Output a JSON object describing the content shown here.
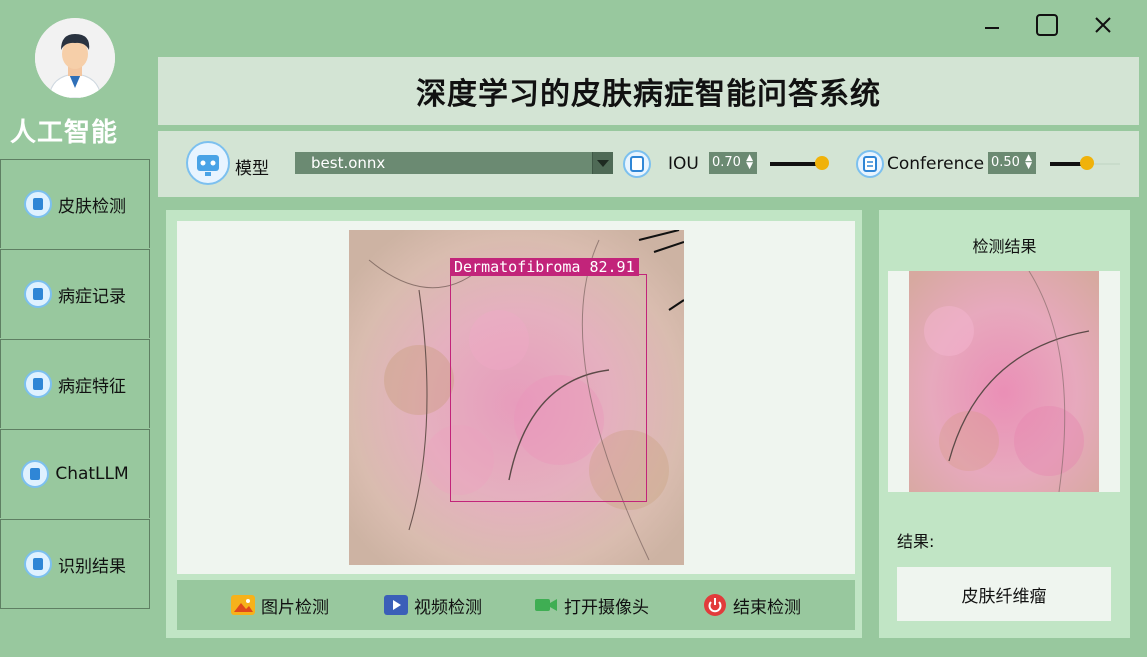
{
  "window": {
    "controls": [
      "minimize-icon",
      "maximize-icon",
      "close-icon"
    ]
  },
  "sidebar": {
    "brand": "人工智能",
    "items": [
      {
        "label": "皮肤检测",
        "icon": "skin-detect-icon"
      },
      {
        "label": "病症记录",
        "icon": "record-icon"
      },
      {
        "label": "病症特征",
        "icon": "feature-icon"
      },
      {
        "label": "ChatLLM",
        "icon": "chat-icon"
      },
      {
        "label": "识别结果",
        "icon": "folder-icon"
      }
    ]
  },
  "header": {
    "title": "深度学习的皮肤病症智能问答系统"
  },
  "toolbar": {
    "model_label": "模型",
    "model_value": "best.onnx",
    "iou_label": "IOU",
    "iou_value": "0.70",
    "iou_level": 0.7,
    "conf_label": "Conference",
    "conf_value": "0.50",
    "conf_level": 0.5
  },
  "detection": {
    "box_label": "Dermatofibroma 82.91",
    "box_color": "#c2247a"
  },
  "actions": [
    {
      "label": "图片检测",
      "icon": "image-icon"
    },
    {
      "label": "视频检测",
      "icon": "video-icon"
    },
    {
      "label": "打开摄像头",
      "icon": "camera-icon"
    },
    {
      "label": "结束检测",
      "icon": "power-icon"
    }
  ],
  "result": {
    "title": "检测结果",
    "label": "结果:",
    "value": "皮肤纤维瘤"
  },
  "colors": {
    "background": "#98c89e",
    "panel": "#c1e5c5",
    "header": "#d3e4d4",
    "accent": "#f0b20a"
  }
}
